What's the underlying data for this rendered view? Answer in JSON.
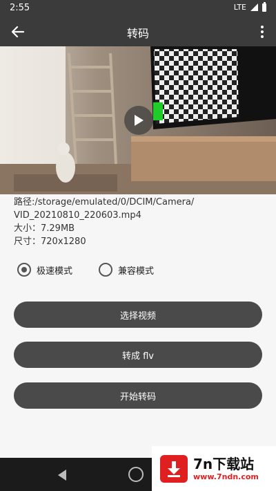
{
  "status_bar": {
    "time": "2:55",
    "network": "LTE"
  },
  "app_bar": {
    "title": "转码"
  },
  "info": {
    "path_line1": "路径:/storage/emulated/0/DCIM/Camera/",
    "path_line2": "VID_20210810_220603.mp4",
    "size": "大小：7.29MB",
    "dimensions": "尺寸：720x1280"
  },
  "modes": [
    {
      "label": "极速模式",
      "selected": true
    },
    {
      "label": "兼容模式",
      "selected": false
    }
  ],
  "buttons": {
    "select_video": "选择视频",
    "convert_flv": "转成 flv",
    "start_convert": "开始转码"
  },
  "watermark": {
    "title": "7n下载站",
    "url": "www.7ndn.com"
  }
}
